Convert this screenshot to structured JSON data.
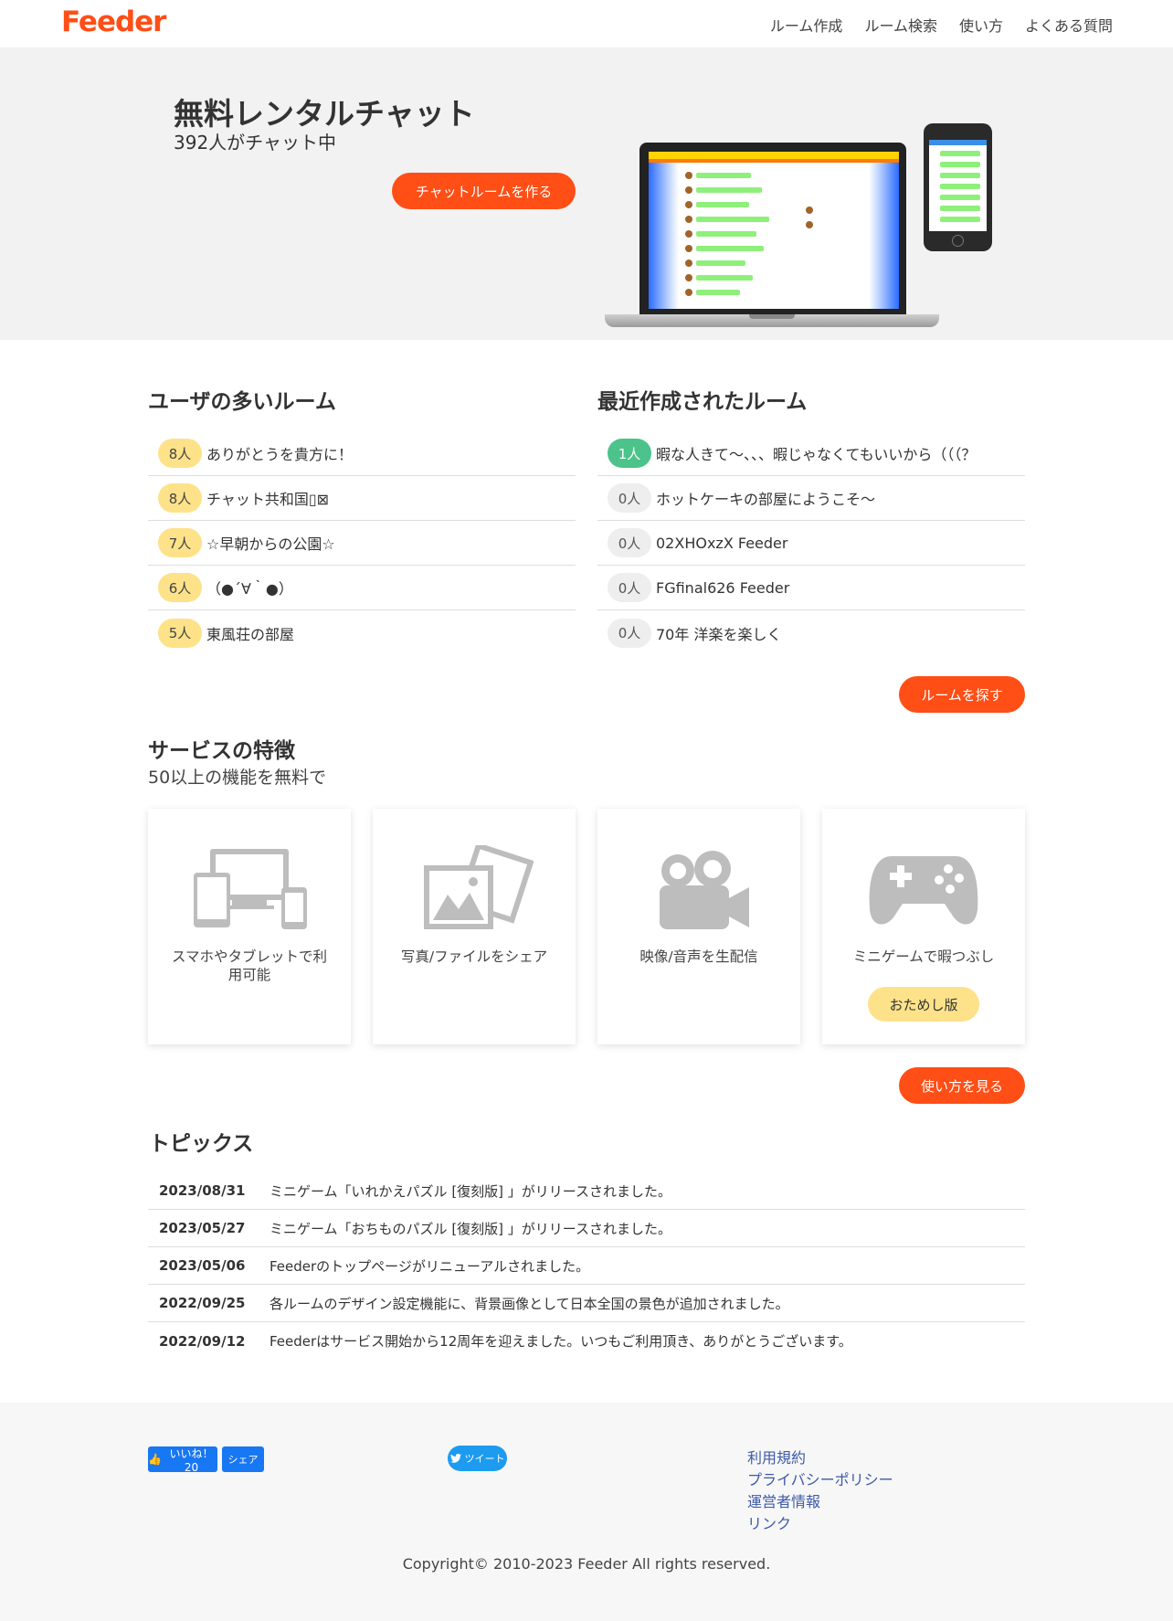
{
  "header": {
    "logo": "Feeder",
    "nav": [
      "ルーム作成",
      "ルーム検索",
      "使い方",
      "よくある質問"
    ]
  },
  "hero": {
    "title": "無料レンタルチャット",
    "subtitle": "392人がチャット中",
    "cta": "チャットルームを作る"
  },
  "popular": {
    "title": "ユーザの多いルーム",
    "rooms": [
      {
        "count": "8人",
        "name": "ありがとうを貴方に！"
      },
      {
        "count": "8人",
        "name": "チャット共和国▯⊠"
      },
      {
        "count": "7人",
        "name": "☆早朝からの公園☆"
      },
      {
        "count": "6人",
        "name": "（●´∀｀●）"
      },
      {
        "count": "5人",
        "name": "東風荘の部屋"
      }
    ]
  },
  "recent": {
    "title": "最近作成されたルーム",
    "rooms": [
      {
        "count": "1人",
        "name": "暇な人きて〜、、、暇じゃなくてもいいから（（（？",
        "active": true
      },
      {
        "count": "0人",
        "name": "ホットケーキの部屋にようこそ〜",
        "active": false
      },
      {
        "count": "0人",
        "name": "02XHOxzX Feeder",
        "active": false
      },
      {
        "count": "0人",
        "name": "FGfinal626 Feeder",
        "active": false
      },
      {
        "count": "0人",
        "name": "70年 洋楽を楽しく",
        "active": false
      }
    ],
    "find_button": "ルームを探す"
  },
  "features": {
    "title": "サービスの特徴",
    "subtitle": "50以上の機能を無料で",
    "cards": [
      {
        "icon": "devices-icon",
        "text": "スマホやタブレットで利用可能"
      },
      {
        "icon": "photos-icon",
        "text": "写真/ファイルをシェア"
      },
      {
        "icon": "video-camera-icon",
        "text": "映像/音声を生配信"
      },
      {
        "icon": "gamepad-icon",
        "text": "ミニゲームで暇つぶし"
      }
    ],
    "trial_button": "おためし版",
    "howto_button": "使い方を見る"
  },
  "topics": {
    "title": "トピックス",
    "items": [
      {
        "date": "2023/08/31",
        "text": "ミニゲーム「いれかえパズル [復刻版] 」がリリースされました。"
      },
      {
        "date": "2023/05/27",
        "text": "ミニゲーム「おちものパズル [復刻版] 」がリリースされました。"
      },
      {
        "date": "2023/05/06",
        "text": "Feederのトップページがリニューアルされました。"
      },
      {
        "date": "2022/09/25",
        "text": "各ルームのデザイン設定機能に、背景画像として日本全国の景色が追加されました。"
      },
      {
        "date": "2022/09/12",
        "text": "Feederはサービス開始から12周年を迎えました。いつもご利用頂き、ありがとうございます。"
      }
    ]
  },
  "footer": {
    "fb_like": "いいね！ 20",
    "fb_share": "シェア",
    "tweet": "ツイート",
    "links": [
      "利用規約",
      "プライバシーポリシー",
      "運営者情報",
      "リンク"
    ],
    "copyright": "Copyright© 2010-2023 Feeder All rights reserved."
  },
  "colors": {
    "brand": "#ff4e16",
    "badge_yellow": "#fde28a",
    "badge_green": "#4cc38a",
    "link": "#3d5aa8"
  }
}
